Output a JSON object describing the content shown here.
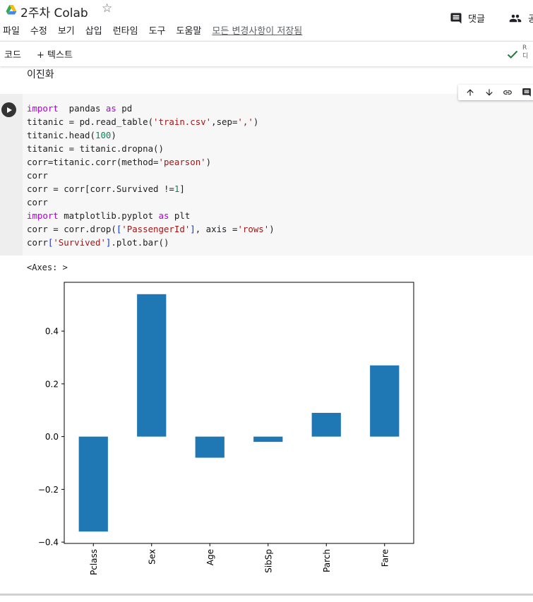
{
  "header": {
    "title": "2주차 Colab",
    "menu": [
      "파일",
      "수정",
      "보기",
      "삽입",
      "런타임",
      "도구",
      "도움말"
    ],
    "saved_status": "모든 변경사항이 저장됨",
    "comment_label": "댓글",
    "share_label": "공"
  },
  "toolbar": {
    "add_code": "코드",
    "add_text": "+ 텍스트",
    "status_r_line1": "R",
    "status_r_line2": "디"
  },
  "text_cell": "이진화",
  "code_lines": [
    [
      [
        "kw",
        "import"
      ],
      [
        "",
        "  pandas "
      ],
      [
        "kw",
        "as"
      ],
      [
        "",
        " pd"
      ]
    ],
    [
      [
        "",
        "titanic = pd.read_table("
      ],
      [
        "str",
        "'train.csv'"
      ],
      [
        "",
        ",sep="
      ],
      [
        "str",
        "','"
      ],
      [
        "",
        ")"
      ]
    ],
    [
      [
        "",
        "titanic.head("
      ],
      [
        "num",
        "100"
      ],
      [
        "",
        ")"
      ]
    ],
    [
      [
        "",
        "titanic = titanic.dropna()"
      ]
    ],
    [
      [
        "",
        "corr=titanic.corr(method="
      ],
      [
        "str",
        "'pearson'"
      ],
      [
        "",
        ")"
      ]
    ],
    [
      [
        "",
        "corr"
      ]
    ],
    [
      [
        "",
        "corr = corr[corr.Survived !="
      ],
      [
        "num",
        "1"
      ],
      [
        "",
        "]"
      ]
    ],
    [
      [
        "",
        "corr"
      ]
    ],
    [
      [
        "kw",
        "import"
      ],
      [
        "",
        " matplotlib.pyplot "
      ],
      [
        "kw",
        "as"
      ],
      [
        "",
        " plt"
      ]
    ],
    [
      [
        "",
        "corr = corr.drop("
      ],
      [
        "brk",
        "["
      ],
      [
        "str",
        "'PassengerId'"
      ],
      [
        "brk",
        "]"
      ],
      [
        "",
        ", axis ="
      ],
      [
        "str",
        "'rows'"
      ],
      [
        "",
        ")"
      ]
    ],
    [
      [
        "",
        "corr"
      ],
      [
        "brk",
        "["
      ],
      [
        "str",
        "'Survived'"
      ],
      [
        "brk",
        "]"
      ],
      [
        "",
        ".plot.bar()"
      ]
    ]
  ],
  "output_text": "<Axes: >",
  "colors": {
    "bar": "#1f77b4"
  },
  "icons": [
    "drive-logo-icon",
    "star-icon",
    "comment-icon",
    "people-icon",
    "check-icon",
    "arrow-up-icon",
    "arrow-down-icon",
    "link-icon",
    "comment-icon",
    "play-icon"
  ],
  "chart_data": {
    "type": "bar",
    "categories": [
      "Pclass",
      "Sex",
      "Age",
      "SibSp",
      "Parch",
      "Fare"
    ],
    "values": [
      -0.36,
      0.54,
      -0.08,
      -0.02,
      0.09,
      0.27
    ],
    "ylim": [
      -0.405,
      0.585
    ],
    "yticks": [
      0.4,
      0.2,
      0.0,
      -0.2,
      -0.4
    ],
    "ytick_labels": [
      "0.4",
      "0.2",
      "0.0",
      "−0.2",
      "−0.4"
    ],
    "grid": false,
    "title": "",
    "xlabel": "",
    "ylabel": ""
  }
}
